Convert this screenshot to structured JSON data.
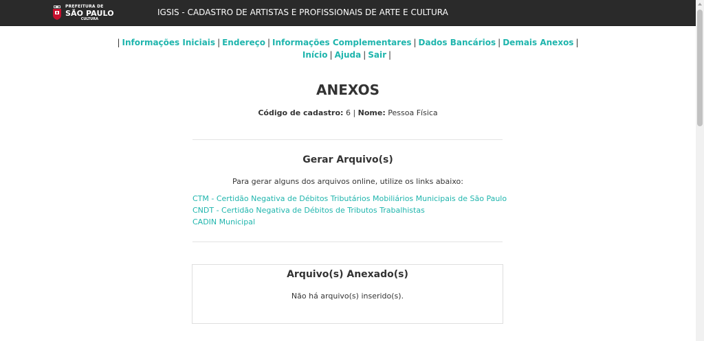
{
  "header": {
    "logo": {
      "line1": "PREFEITURA DE",
      "line2": "SÃO PAULO",
      "line3": "CULTURA"
    },
    "title": "IGSIS - CADASTRO DE ARTISTAS E PROFISSIONAIS DE ARTE E CULTURA"
  },
  "nav": {
    "row1": [
      "Informações Iniciais",
      "Endereço",
      "Informações Complementares",
      "Dados Bancários",
      "Demais Anexos"
    ],
    "row2": [
      "Início",
      "Ajuda",
      "Sair"
    ]
  },
  "page": {
    "title": "ANEXOS",
    "code_label": "Código de cadastro:",
    "code_value": "6",
    "name_label": "Nome:",
    "name_value": "Pessoa Física"
  },
  "generate": {
    "title": "Gerar Arquivo(s)",
    "instructions": "Para gerar alguns dos arquivos online, utilize os links abaixo:",
    "links": [
      "CTM - Certidão Negativa de Débitos Tributários Mobiliários Municipais de São Paulo",
      "CNDT - Certidão Negativa de Débitos de Tributos Trabalhistas",
      "CADIN Municipal"
    ]
  },
  "attached": {
    "title": "Arquivo(s) Anexado(s)",
    "empty_message": "Não há arquivo(s) inserido(s)."
  },
  "colors": {
    "header_bg": "#2a2a2a",
    "link": "#1fb5ad",
    "text": "#333333"
  }
}
